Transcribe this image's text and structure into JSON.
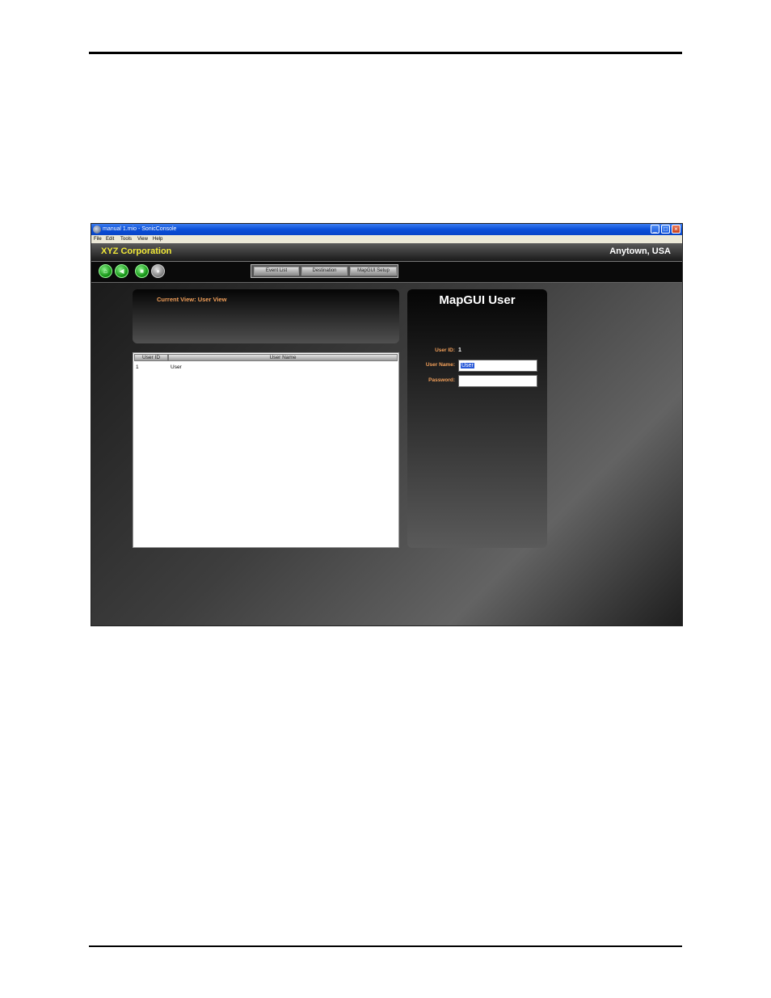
{
  "window": {
    "title": "manual 1.mio - SonicConsole",
    "controls": {
      "minimize": "_",
      "maximize": "□",
      "close": "×"
    }
  },
  "menu": [
    "File",
    "Edit",
    "Tools",
    "View",
    "Help"
  ],
  "header": {
    "company": "XYZ Corporation",
    "location": "Anytown, USA"
  },
  "toolbar": {
    "icons": [
      "home-icon",
      "back-arrow-icon",
      "stop-icon",
      "record-icon"
    ],
    "icon_glyphs": [
      "⌂",
      "◀",
      "■",
      "●"
    ],
    "nav": [
      "Event List",
      "Destination",
      "MapGUI Setup"
    ]
  },
  "view": {
    "current_view": "Current View: User View"
  },
  "table": {
    "columns": [
      "User ID",
      "User Name"
    ],
    "rows": [
      [
        "1",
        "User"
      ]
    ]
  },
  "user_panel": {
    "title": "MapGUI User",
    "user_id_label": "User ID:",
    "user_id_value": "1",
    "user_name_label": "User Name:",
    "user_name_value": "User",
    "password_label": "Password:",
    "password_value": ""
  },
  "colors": {
    "company_text": "#f0e838",
    "label_orange": "#f3a05a",
    "titlebar_blue": "#0a4fd8"
  }
}
